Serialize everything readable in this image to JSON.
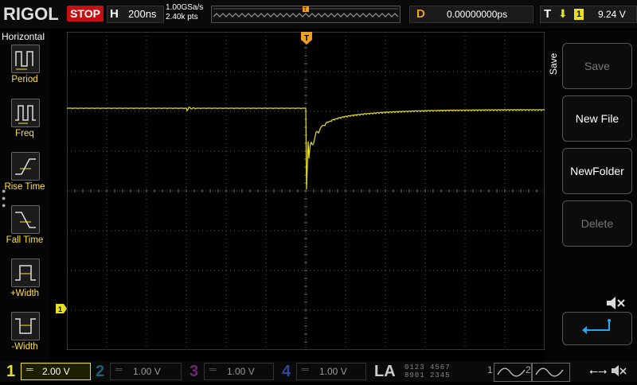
{
  "brand": {
    "logo": "RIGOL"
  },
  "status": {
    "run_state": "STOP"
  },
  "horizontal": {
    "label": "H",
    "timebase": "200ns"
  },
  "acquisition": {
    "sample_rate": "1.00GSa/s",
    "memory": "2.40k pts"
  },
  "delay": {
    "label": "D",
    "value": "0.00000000ps"
  },
  "trigger": {
    "label": "T",
    "source": "1",
    "level": "9.24 V"
  },
  "left_menu": {
    "title": "Horizontal",
    "items": [
      {
        "label": "Period",
        "icon": "period-icon"
      },
      {
        "label": "Freq",
        "icon": "freq-icon"
      },
      {
        "label": "Rise Time",
        "icon": "rise-time-icon"
      },
      {
        "label": "Fall Time",
        "icon": "fall-time-icon"
      },
      {
        "label": "+Width",
        "icon": "pos-width-icon"
      },
      {
        "label": "-Width",
        "icon": "neg-width-icon"
      }
    ]
  },
  "right_menu": {
    "title": "Save",
    "buttons": [
      {
        "label": "Save",
        "enabled": false
      },
      {
        "label": "New File",
        "enabled": true
      },
      {
        "label": "NewFolder",
        "enabled": true
      },
      {
        "label": "Delete",
        "enabled": false
      },
      {
        "label": "",
        "icon": "return-icon",
        "enabled": true
      }
    ]
  },
  "channels": [
    {
      "num": "1",
      "scale": "2.00 V",
      "color": "#e8e020",
      "active": true
    },
    {
      "num": "2",
      "scale": "1.00 V",
      "color": "#29a8c4",
      "active": false
    },
    {
      "num": "3",
      "scale": "1.00 V",
      "color": "#c040c0",
      "active": false
    },
    {
      "num": "4",
      "scale": "1.00 V",
      "color": "#4060d0",
      "active": false
    }
  ],
  "logic_analyzer": {
    "label": "LA",
    "row1": "0123 4567",
    "row2": "8901 2345"
  },
  "generators": [
    {
      "num": "1"
    },
    {
      "num": "2"
    }
  ],
  "colors": {
    "ch1": "#e8e020",
    "grid": "#6a6a6a",
    "trigger_marker": "#f0a020"
  }
}
